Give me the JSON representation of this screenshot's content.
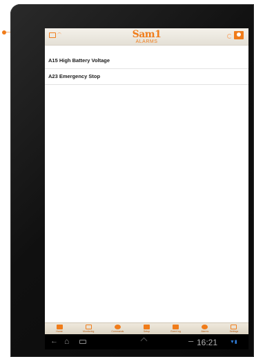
{
  "app": {
    "logo": "Sam1",
    "page_title": "ALARMS"
  },
  "alarms": [
    {
      "label": "A15 High Battery Voltage"
    },
    {
      "label": "A23 Emergency Stop"
    }
  ],
  "bottom_nav": [
    {
      "label": "Home",
      "icon": "home-icon"
    },
    {
      "label": "Monitoring",
      "icon": "monitoring-icon"
    },
    {
      "label": "Commands",
      "icon": "commands-icon"
    },
    {
      "label": "Setup",
      "icon": "setup-icon"
    },
    {
      "label": "Event log",
      "icon": "event-log-icon"
    },
    {
      "label": "Alarms",
      "icon": "alarms-icon"
    },
    {
      "label": "Settings",
      "icon": "settings-icon"
    }
  ],
  "system_bar": {
    "time": "16:21"
  },
  "colors": {
    "accent": "#f07c1a",
    "screen_bg": "#ffffff",
    "bezel": "#111111"
  }
}
